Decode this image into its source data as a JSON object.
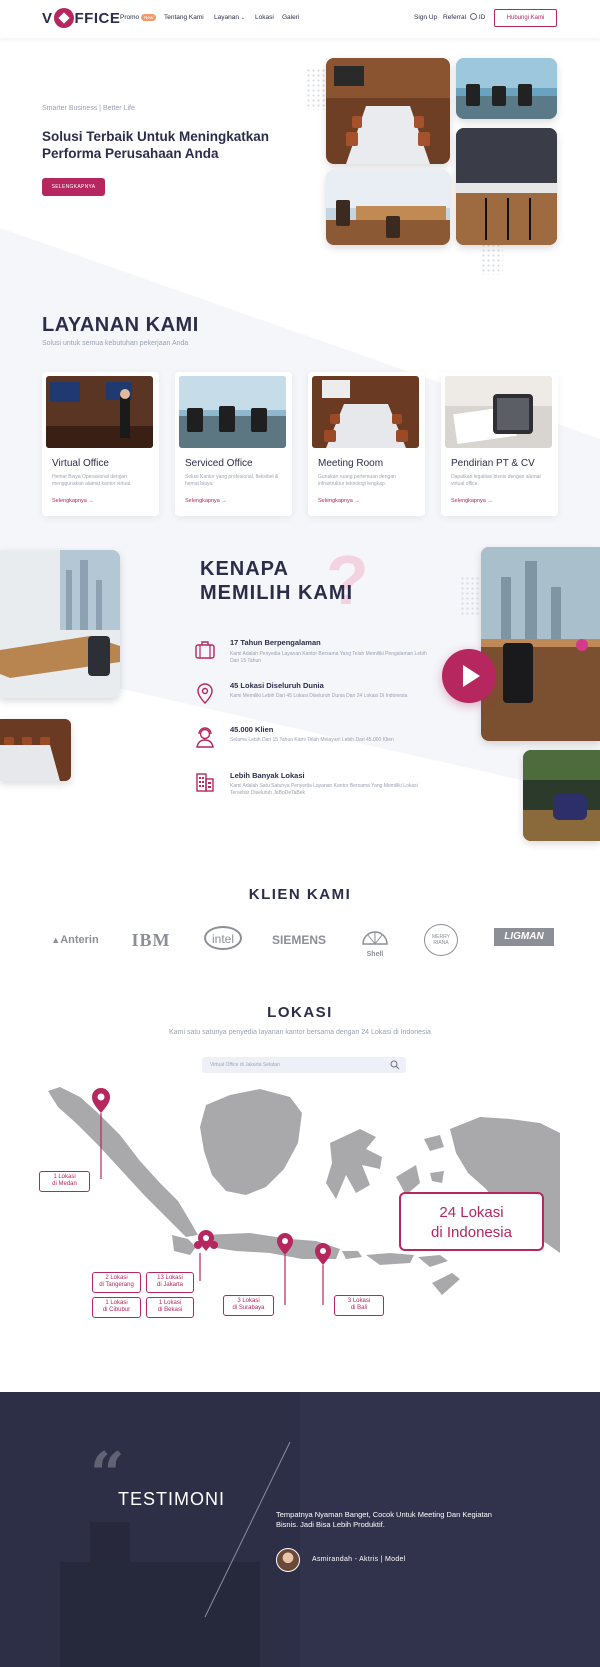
{
  "header": {
    "logo_text_left": "V",
    "logo_text_right": "FFICE",
    "nav": [
      {
        "label": "Promo",
        "badge": "New"
      },
      {
        "label": "Tentang Kami"
      },
      {
        "label": "Layanan"
      },
      {
        "label": "Lokasi"
      },
      {
        "label": "Galeri"
      }
    ],
    "signup": "Sign Up",
    "referral": "Referral",
    "language": "ID",
    "cta": "Hubungi Kami"
  },
  "hero": {
    "tagline": "Smarter Business | Better Life",
    "title": "Solusi Terbaik Untuk Meningkatkan Performa Perusahaan Anda",
    "button": "SELENGKAPNYA"
  },
  "layanan": {
    "title": "LAYANAN KAMI",
    "subtitle": "Solusi untuk semua kebutuhan pekerjaan Anda",
    "cards": [
      {
        "title": "Virtual Office",
        "desc": "Hemat Biaya Operasional dengan menggunakan alamat kantor virtual.",
        "link": "Selengkapnya →"
      },
      {
        "title": "Serviced Office",
        "desc": "Solusi Kantor yang profesional, fleksibel & hemat biaya.",
        "link": "Selengkapnya →"
      },
      {
        "title": "Meeting Room",
        "desc": "Gunakan ruang pertemuan dengan infrastruktur teknologi lengkap.",
        "link": "Selengkapnya →"
      },
      {
        "title": "Pendirian PT & CV",
        "desc": "Dapatkan legalitas bisnis dengan alamat virtual office.",
        "link": "Selengkapnya →"
      }
    ]
  },
  "kenapa": {
    "title_line1": "KENAPA",
    "title_line2": "MEMILIH KAMI",
    "features": [
      {
        "icon": "briefcase-icon",
        "title": "17 Tahun Berpengalaman",
        "desc": "Kami Adalah Penyedia Layanan Kantor Bersama Yang Telah Memiliki Pengalaman Lebih Dari 15 Tahun"
      },
      {
        "icon": "location-pin-icon",
        "title": "45 Lokasi Diseluruh Dunia",
        "desc": "Kami Memiliki Lebih Dari 45 Lokasi Diseluruh Dunia Dan 24 Lokasi Di Indonesia"
      },
      {
        "icon": "headset-user-icon",
        "title": "45.000 Klien",
        "desc": "Selama Lebih Dari 15 Tahun Kami Telah Melayani Lebih Dari 45.000 Klien"
      },
      {
        "icon": "building-icon",
        "title": "Lebih Banyak Lokasi",
        "desc": "Kami Adalah Satu Satunya Penyedia Layanan Kantor Bersama Yang Memiliki Lokasi Tersebar Diseluruh JaBoDeTaBek"
      }
    ]
  },
  "klien": {
    "title": "KLIEN KAMI",
    "logos": [
      "Anterin",
      "IBM",
      "intel",
      "SIEMENS",
      "Shell",
      "MERRY RIANA",
      "LIGMAN"
    ]
  },
  "lokasi": {
    "title": "LOKASI",
    "subtitle": "Kami satu satunya penyedia layanan kantor bersama dengan 24 Lokasi di Indonesia",
    "search_placeholder": "Virtual Office di Jakarta Selatan",
    "big_label_line1": "24 Lokasi",
    "big_label_line2": "di Indonesia",
    "labels": [
      {
        "l1": "1 Lokasi",
        "l2": "di Medan"
      },
      {
        "l1": "2 Lokasi",
        "l2": "di Tangerang"
      },
      {
        "l1": "13 Lokasi",
        "l2": "di Jakarta"
      },
      {
        "l1": "1 Lokasi",
        "l2": "di Cibubur"
      },
      {
        "l1": "1 Lokasi",
        "l2": "di Bekasi"
      },
      {
        "l1": "3 Lokasi",
        "l2": "di Surabaya"
      },
      {
        "l1": "3 Lokasi",
        "l2": "di Bali"
      }
    ]
  },
  "testimoni": {
    "title": "TESTIMONI",
    "text": "Tempatnya Nyaman Banget, Cocok Untuk Meeting Dan Kegiatan Bisnis. Jadi Bisa Lebih Produktif.",
    "author": "Asmirandah - Aktris | Model"
  },
  "colors": {
    "accent": "#b5275e",
    "dark": "#2b2d4a",
    "muted": "#9aa0b4",
    "testimonial_bg": "#2d2f47"
  }
}
